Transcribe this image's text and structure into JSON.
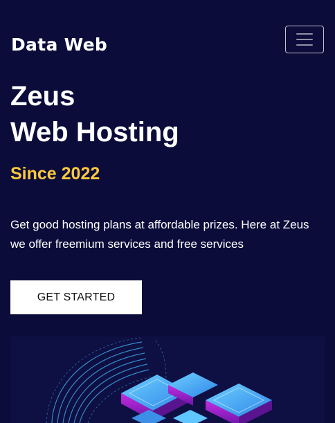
{
  "navbar": {
    "brand": "Data Web",
    "toggler_aria": "Toggle navigation"
  },
  "hero": {
    "title_line1": "Zeus",
    "title_line2": "Web Hosting",
    "since": "Since 2022",
    "description": "Get good hosting plans at affordable prizes. Here at Zeus we offer freemium services and free services",
    "cta_label": "GET STARTED"
  },
  "colors": {
    "background": "#0b0c3a",
    "accent": "#ffc83d",
    "button_bg": "#ffffff",
    "illustration_cyan": "#4fb3ff",
    "illustration_purple": "#b01fd6"
  },
  "illustration": {
    "icon": "server-stack-illustration"
  }
}
